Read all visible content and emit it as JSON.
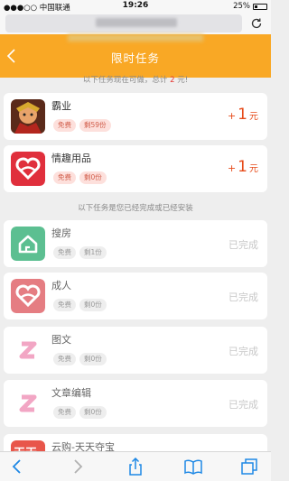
{
  "status_bar": {
    "carrier": "●●●○○ 中国联通",
    "time": "19:26",
    "battery": "25%"
  },
  "nav": {
    "title": "限时任务"
  },
  "available_tip": {
    "prefix": "以下任务现在可做，总计 ",
    "amount": "2",
    "suffix": " 元!"
  },
  "available_tasks": [
    {
      "name": "霸业",
      "free_label": "免费",
      "remaining": "剩59份",
      "reward_plus": "+",
      "reward_value": "1",
      "reward_unit": "元"
    },
    {
      "name": "情趣用品",
      "free_label": "免费",
      "remaining": "剩0份",
      "reward_plus": "+",
      "reward_value": "1",
      "reward_unit": "元"
    }
  ],
  "completed_tip": "以下任务是您已经完成或已经安装",
  "completed_tasks": [
    {
      "name": "搜房",
      "free_label": "免费",
      "remaining": "剩1份",
      "status": "已完成"
    },
    {
      "name": "成人",
      "free_label": "免费",
      "remaining": "剩0份",
      "status": "已完成"
    },
    {
      "name": "图文",
      "free_label": "免费",
      "remaining": "剩0份",
      "status": "已完成"
    },
    {
      "name": "文章编辑",
      "free_label": "免费",
      "remaining": "剩0份",
      "status": "已完成"
    },
    {
      "name": "云购-天天夺宝",
      "free_label": "",
      "remaining": "",
      "status": ""
    }
  ],
  "icon_glyphs": {
    "tiantian": "天天"
  },
  "colors": {
    "nav_bg": "#f9a825",
    "reward": "#e64a19",
    "accent_red": "#e53935"
  }
}
